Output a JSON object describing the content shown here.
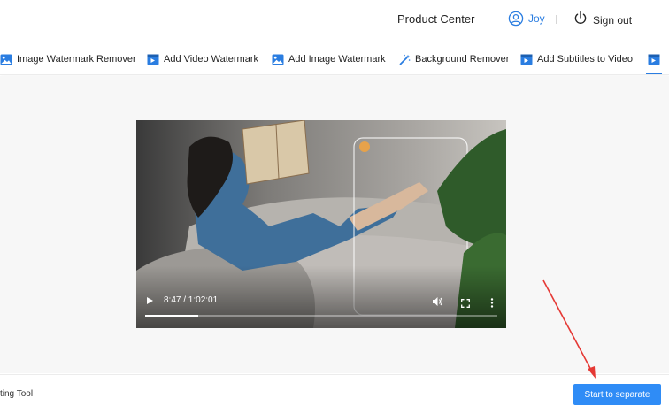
{
  "header": {
    "product_center": "Product Center",
    "user_name": "Joy",
    "sign_out": "Sign out"
  },
  "tabs": [
    {
      "label": "Image Watermark Remover",
      "icon": "image-icon"
    },
    {
      "label": "Add Video Watermark",
      "icon": "video-edit-icon"
    },
    {
      "label": "Add Image Watermark",
      "icon": "image-icon"
    },
    {
      "label": "Background Remover",
      "icon": "magic-wand-icon"
    },
    {
      "label": "Add Subtitles to Video",
      "icon": "video-edit-icon"
    }
  ],
  "video": {
    "time": "8:47 / 1:02:01",
    "progress": 0.15
  },
  "footer": {
    "label": "ting Tool",
    "start_button": "Start to separate"
  },
  "colors": {
    "accent": "#2a7de1",
    "button": "#2f8cf6",
    "annotation_arrow": "#e53935"
  }
}
